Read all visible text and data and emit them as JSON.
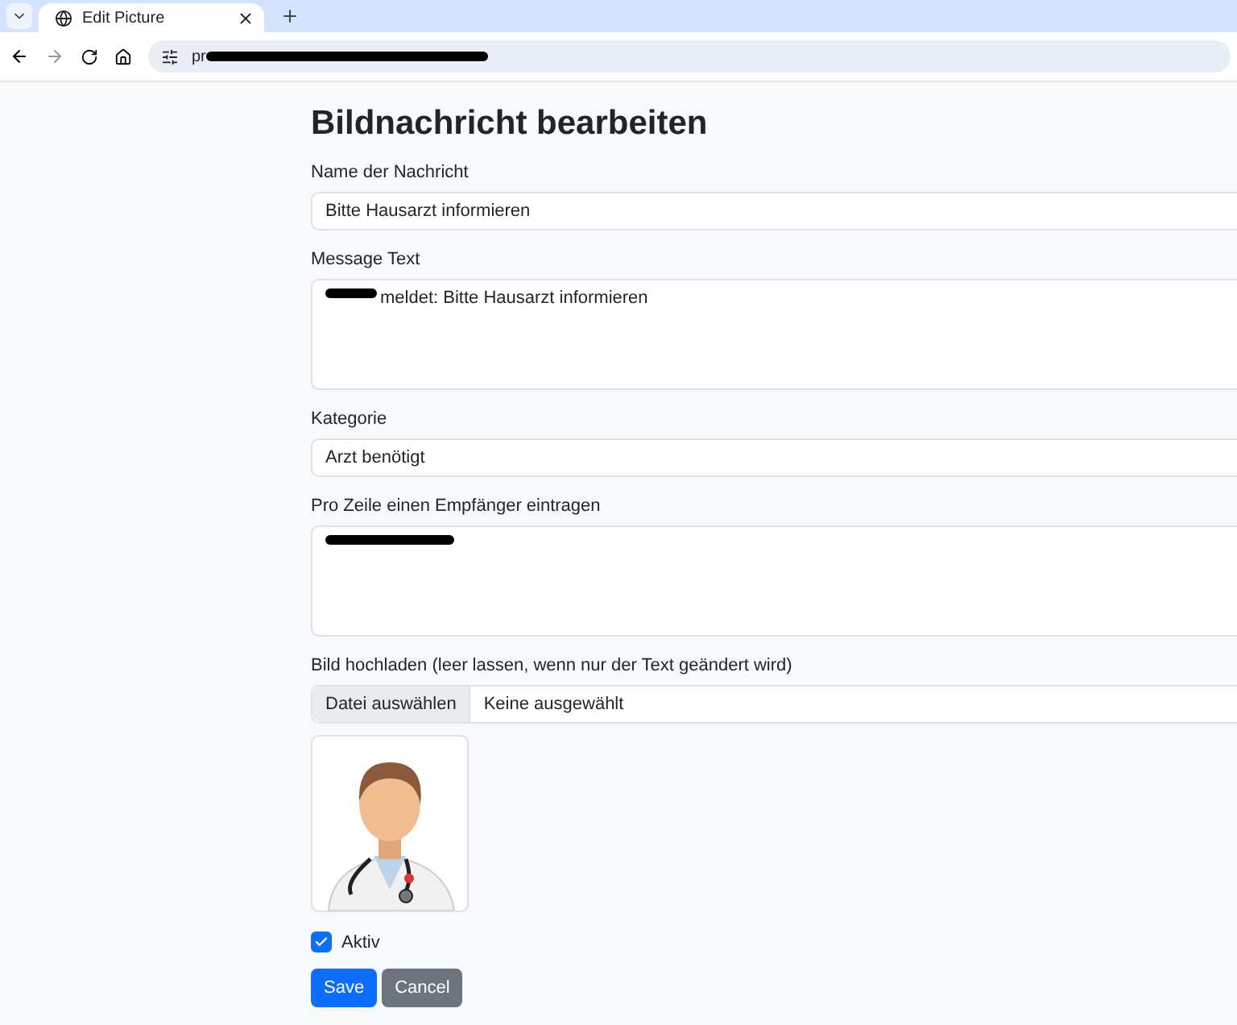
{
  "browser": {
    "tab_title": "Edit Picture",
    "url": "pr"
  },
  "page": {
    "title": "Bildnachricht bearbeiten",
    "fields": [
      {
        "kind": "input",
        "label": "Name der Nachricht",
        "value": "Bitte Hausarzt informieren"
      },
      {
        "kind": "textarea",
        "label": "Message Text",
        "value": "meldet: Bitte Hausarzt informieren",
        "redacted": true
      },
      {
        "kind": "select",
        "label": "Kategorie",
        "value": "Arzt benötigt"
      },
      {
        "kind": "textarea",
        "label": "Pro Zeile einen Empfänger eintragen",
        "redacted": true
      },
      {
        "kind": "file",
        "label": "Bild hochladen (leer lassen, wenn nur der Text geändert wird)",
        "button": "Datei auswählen",
        "value": "Keine ausgewählt"
      }
    ],
    "active": {
      "label": "Aktiv",
      "checked": true
    },
    "buttons": [
      {
        "label": "Save",
        "kind": "primary"
      },
      {
        "label": "Cancel",
        "kind": "secondary"
      }
    ]
  }
}
